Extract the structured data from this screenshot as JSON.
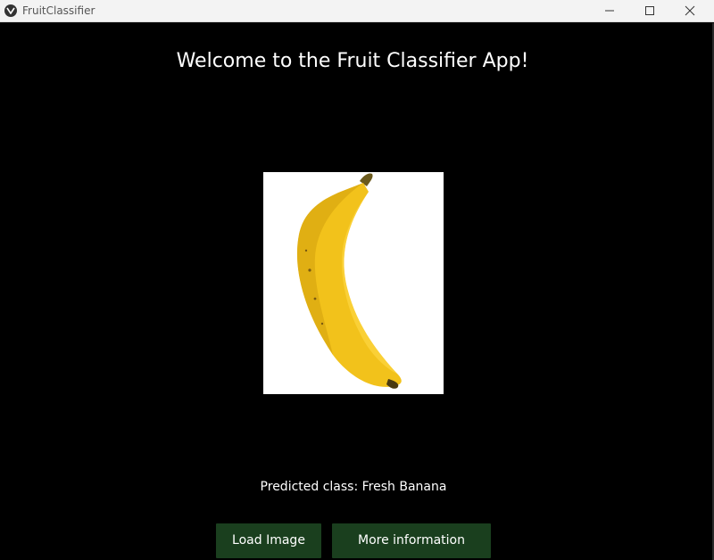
{
  "window": {
    "title": "FruitClassifier"
  },
  "main": {
    "heading": "Welcome to the Fruit Classifier App!",
    "image_subject": "Banana",
    "prediction_text": "Predicted class: Fresh Banana"
  },
  "actions": {
    "load_label": "Load Image",
    "info_label": "More information"
  },
  "colors": {
    "background": "#000000",
    "button": "#1a3f1e",
    "banana": "#f2c21b"
  }
}
